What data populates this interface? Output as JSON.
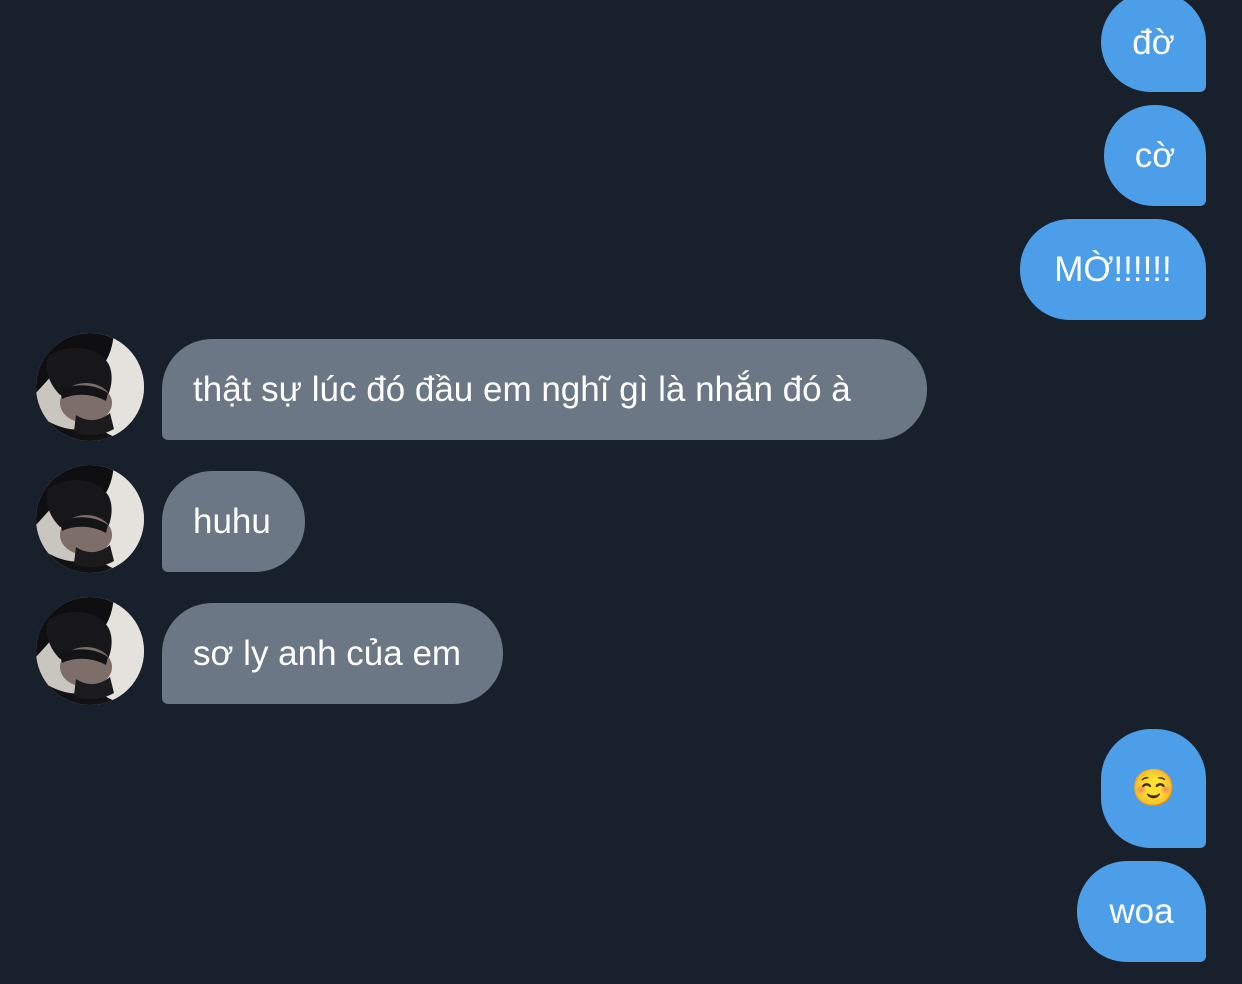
{
  "conversation": {
    "colors": {
      "background": "#18202b",
      "sent_bubble": "#4c9ee8",
      "received_bubble": "#6b7784",
      "text": "#ffffff"
    },
    "messages": [
      {
        "direction": "sent",
        "text": "đờ"
      },
      {
        "direction": "sent",
        "text": "cờ"
      },
      {
        "direction": "sent",
        "text": "MỜ!!!!!!"
      },
      {
        "direction": "received",
        "text": "thật sự lúc đó đầu em nghĩ gì là nhắn đó à",
        "avatar": "profile-photo"
      },
      {
        "direction": "received",
        "text": "huhu",
        "avatar": "profile-photo"
      },
      {
        "direction": "received",
        "text": "sơ ly anh của em",
        "avatar": "profile-photo"
      },
      {
        "direction": "sent",
        "text": "☺️"
      },
      {
        "direction": "sent",
        "text": "woa"
      }
    ]
  }
}
